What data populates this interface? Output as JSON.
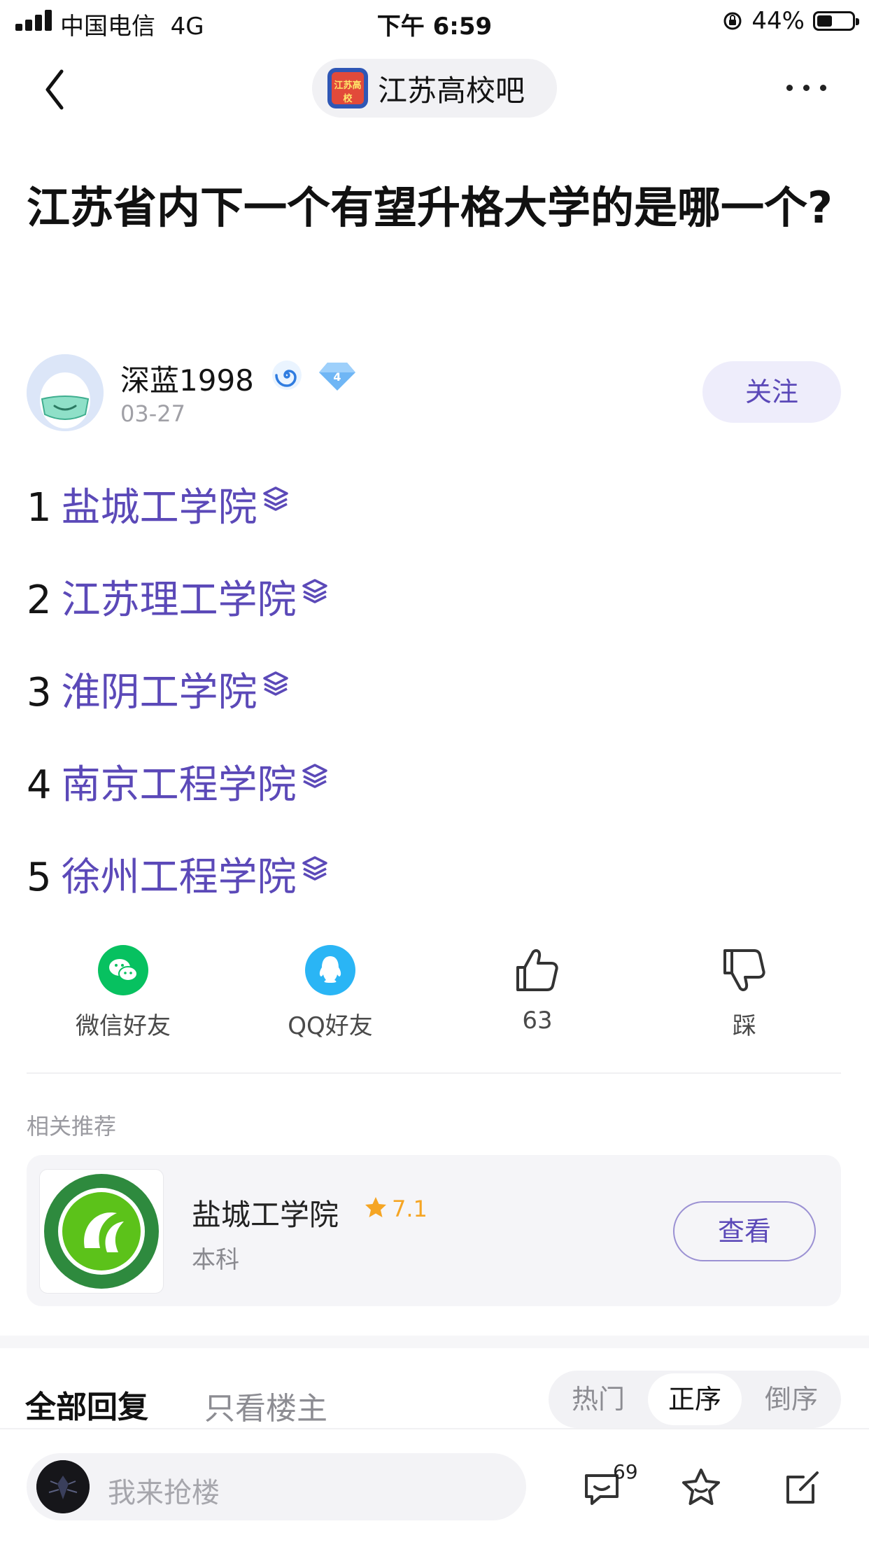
{
  "status_bar": {
    "carrier": "中国电信",
    "network": "4G",
    "time": "下午 6:59",
    "battery": "44%",
    "battery_level": 0.44
  },
  "nav": {
    "forum_name": "江苏高校吧",
    "forum_logo_text": "江苏高校"
  },
  "post": {
    "title": "江苏省内下一个有望升格大学的是哪一个?",
    "author": "深蓝1998",
    "level": "4",
    "date": "03-27",
    "follow_label": "关注",
    "list": [
      {
        "num": "1",
        "name": "盐城工学院"
      },
      {
        "num": "2",
        "name": "江苏理工学院"
      },
      {
        "num": "3",
        "name": "淮阴工学院"
      },
      {
        "num": "4",
        "name": "南京工程学院"
      },
      {
        "num": "5",
        "name": "徐州工程学院"
      }
    ]
  },
  "actions": {
    "wechat": "微信好友",
    "qq": "QQ好友",
    "likes": "63",
    "dislike": "踩"
  },
  "recommend": {
    "section_label": "相关推荐",
    "name": "盐城工学院",
    "score": "7.1",
    "sub": "本科",
    "button": "查看"
  },
  "replies": {
    "tab_all": "全部回复",
    "tab_op": "只看楼主",
    "sort": [
      "热门",
      "正序",
      "倒序"
    ],
    "active_sort": "正序"
  },
  "bottom_bar": {
    "placeholder": "我来抢楼",
    "comment_count": "69"
  },
  "colors": {
    "accent": "#5b49b8",
    "wechat": "#07c160",
    "qq": "#2ab5f5",
    "star": "#f5a524"
  }
}
